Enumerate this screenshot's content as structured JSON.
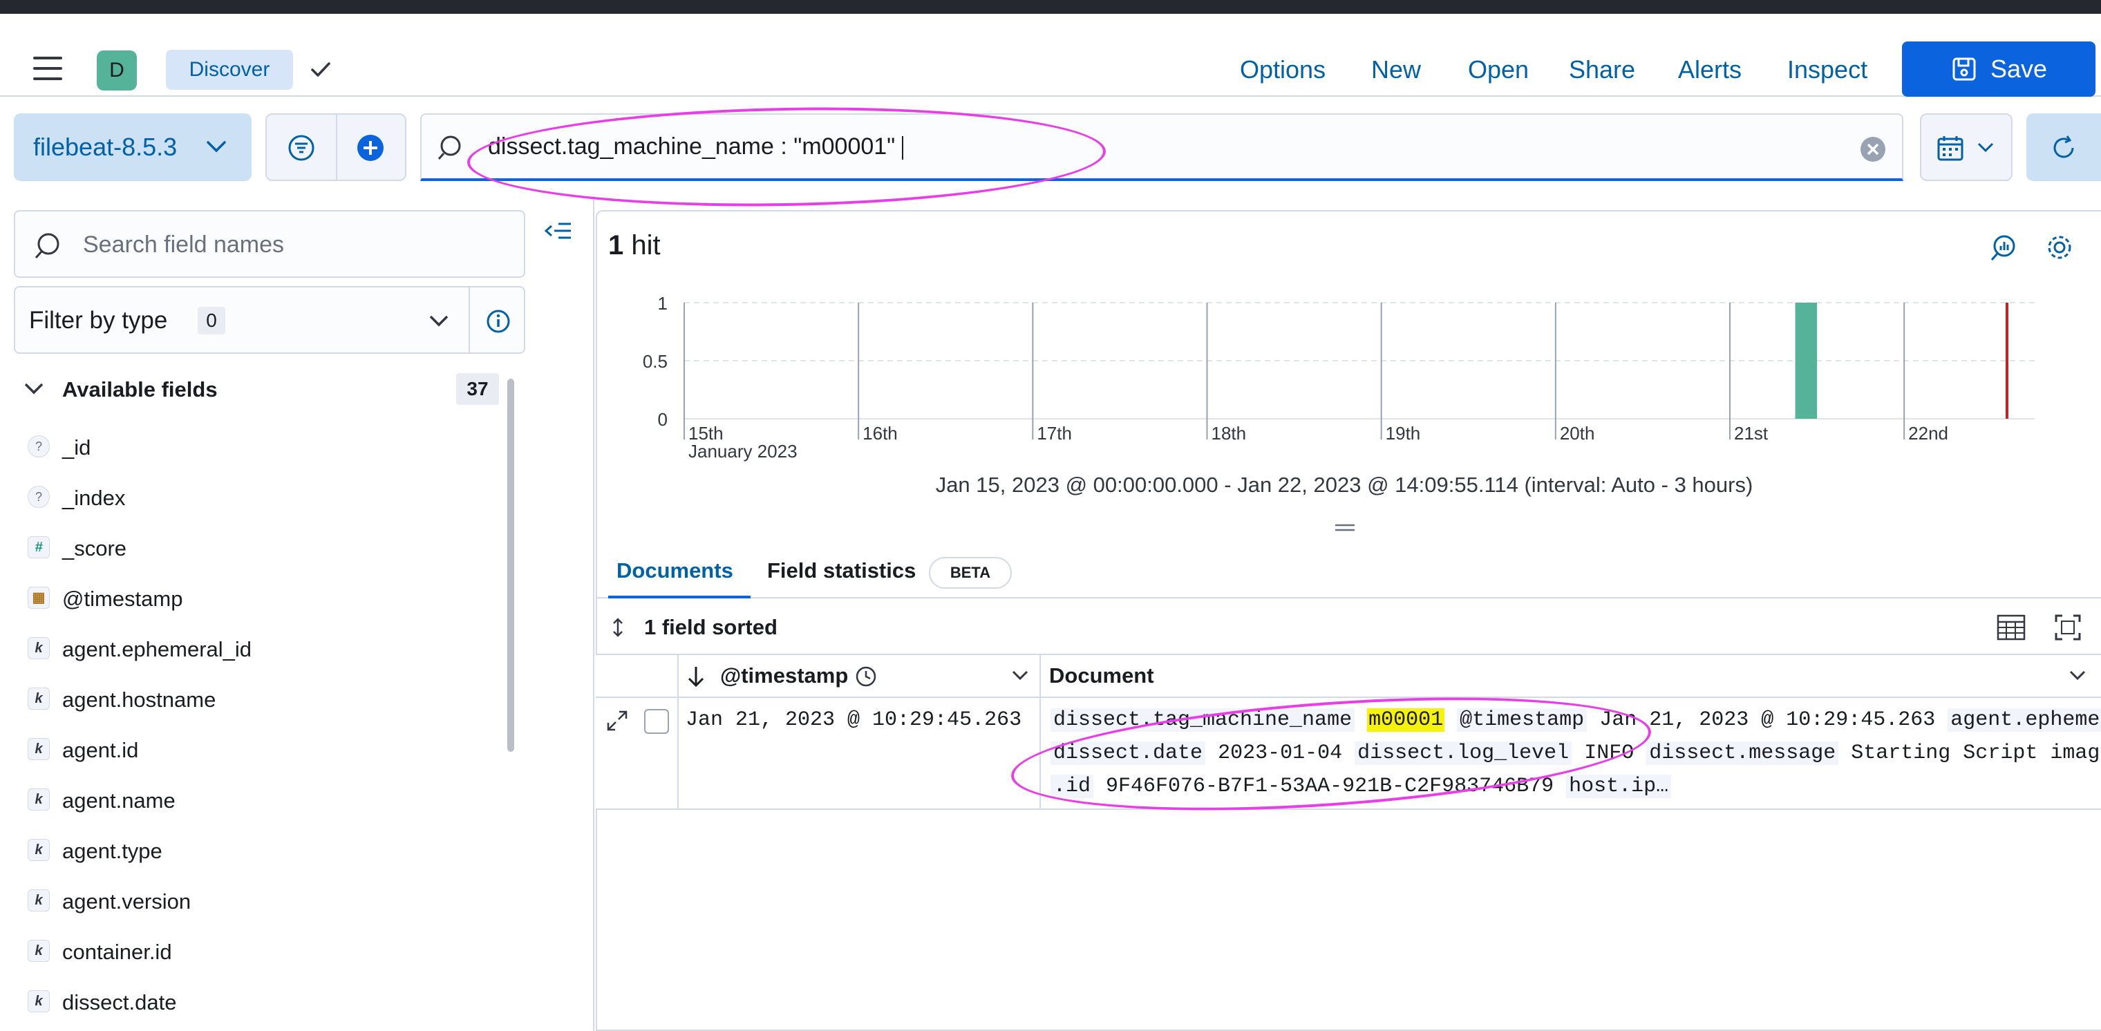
{
  "header": {
    "avatar_letter": "D",
    "breadcrumb": "Discover",
    "links": [
      "Options",
      "New",
      "Open",
      "Share",
      "Alerts",
      "Inspect"
    ],
    "save_label": "Save"
  },
  "query": {
    "data_view": "filebeat-8.5.3",
    "text": "dissect.tag_machine_name : \"m00001\""
  },
  "sidebar": {
    "search_placeholder": "Search field names",
    "filter_label": "Filter by type",
    "filter_count": "0",
    "available_label": "Available fields",
    "available_count": "37",
    "fields": [
      {
        "type": "?",
        "name": "_id"
      },
      {
        "type": "?",
        "name": "_index"
      },
      {
        "type": "#",
        "name": "_score"
      },
      {
        "type": "date",
        "name": "@timestamp"
      },
      {
        "type": "k",
        "name": "agent.ephemeral_id"
      },
      {
        "type": "k",
        "name": "agent.hostname"
      },
      {
        "type": "k",
        "name": "agent.id"
      },
      {
        "type": "k",
        "name": "agent.name"
      },
      {
        "type": "k",
        "name": "agent.type"
      },
      {
        "type": "k",
        "name": "agent.version"
      },
      {
        "type": "k",
        "name": "container.id"
      },
      {
        "type": "k",
        "name": "dissect.date"
      }
    ]
  },
  "main": {
    "hits_count": "1",
    "hits_label": "hit",
    "time_range": "Jan 15, 2023 @ 00:00:00.000 - Jan 22, 2023 @ 14:09:55.114 (interval: Auto - 3 hours)",
    "tabs": {
      "documents": "Documents",
      "field_stats": "Field statistics",
      "beta": "BETA"
    },
    "sorted_label": "1 field sorted",
    "columns": {
      "timestamp": "@timestamp",
      "document": "Document"
    },
    "row": {
      "timestamp": "Jan 21, 2023 @ 10:29:45.263",
      "line1": [
        {
          "k": "dissect.tag_machine_name"
        },
        {
          "v": "m00001",
          "hl": true
        },
        {
          "k": "@timestamp"
        },
        {
          "v": "Jan 21, 2023 @ 10:29:45.263"
        },
        {
          "k": "agent.epheme"
        }
      ],
      "line2": [
        {
          "k": "dissect.date"
        },
        {
          "v": "2023-01-04"
        },
        {
          "k": "dissect.log_level"
        },
        {
          "v": "INFO"
        },
        {
          "k": "dissect.message"
        },
        {
          "v": "Starting Script imag"
        }
      ],
      "line3": [
        {
          "k": ".id"
        },
        {
          "v": "9F46F076-B7F1-53AA-921B-C2F983746B79"
        },
        {
          "k": "host.ip…"
        }
      ]
    }
  },
  "chart_data": {
    "type": "bar",
    "y_ticks": [
      "1",
      "0.5",
      "0"
    ],
    "ylim": [
      0,
      1
    ],
    "x_ticks": [
      "15th",
      "16th",
      "17th",
      "18th",
      "19th",
      "20th",
      "21st",
      "22nd"
    ],
    "x_sublabel": "January 2023",
    "bars": [
      {
        "x": "2023-01-21T09:00",
        "value": 1
      }
    ],
    "bar_color": "#54b399",
    "now_marker_color": "#bd271e"
  }
}
